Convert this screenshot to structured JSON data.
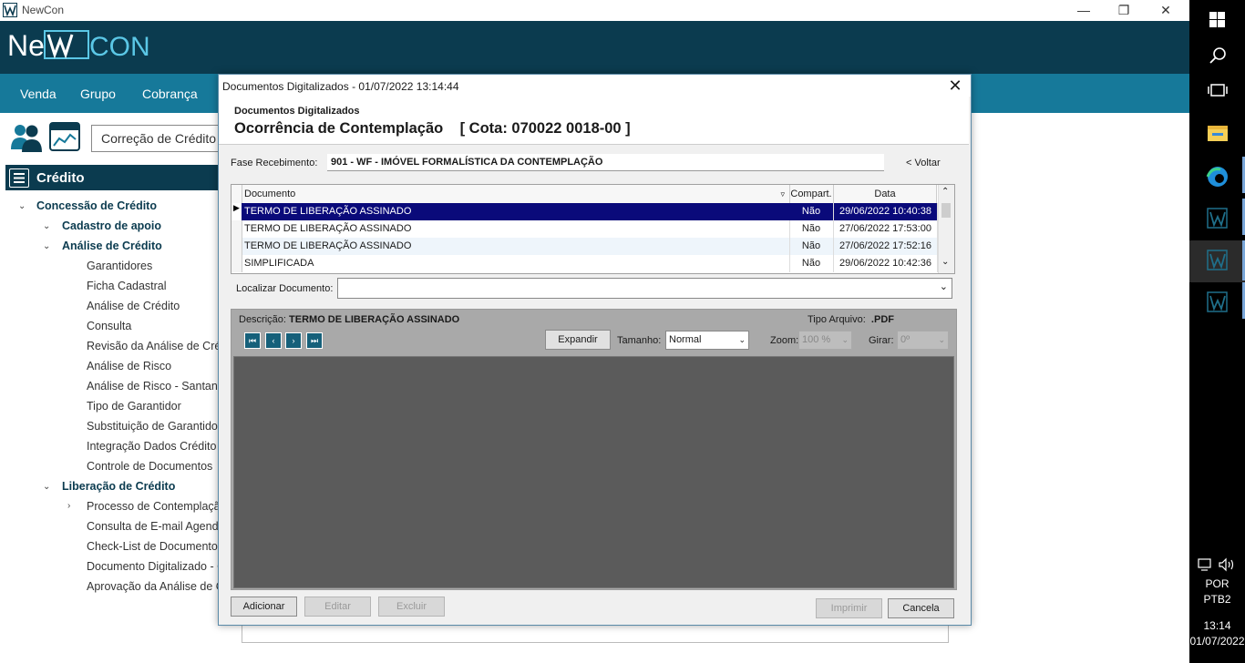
{
  "app": {
    "title": "NewCon",
    "logo_text": "NewCon",
    "menu": [
      "Venda",
      "Grupo",
      "Cobrança"
    ],
    "breadcrumb_value": "Correção de Crédito",
    "sidebar_header": "Crédito",
    "tree": [
      {
        "label": "Concessão de Crédito",
        "level": 1,
        "expanded": true
      },
      {
        "label": "Cadastro de apoio",
        "level": 2,
        "expanded": true
      },
      {
        "label": "Análise de Crédito",
        "level": 2,
        "expanded": true
      },
      {
        "label": "Garantidores",
        "level": 3
      },
      {
        "label": "Ficha Cadastral",
        "level": 3
      },
      {
        "label": "Análise de Crédito",
        "level": 3
      },
      {
        "label": "Consulta",
        "level": 3
      },
      {
        "label": "Revisão da Análise de Cré",
        "level": 3
      },
      {
        "label": "Análise de Risco",
        "level": 3
      },
      {
        "label": "Análise de Risco - Santan",
        "level": 3
      },
      {
        "label": "Tipo de Garantidor",
        "level": 3
      },
      {
        "label": "Substituição de Garantidor",
        "level": 3
      },
      {
        "label": "Integração Dados Crédito",
        "level": 3
      },
      {
        "label": "Controle de Documentos",
        "level": 3
      },
      {
        "label": "Liberação de Crédito",
        "level": 2,
        "expanded": true
      },
      {
        "label": "Processo de Contemplaçã",
        "level": 3,
        "collapsed": true
      },
      {
        "label": "Consulta de E-mail Agend",
        "level": 3
      },
      {
        "label": "Check-List de Documento",
        "level": 3
      },
      {
        "label": "Documento Digitalizado - C",
        "level": 3
      },
      {
        "label": "Aprovação da Análise de C",
        "level": 3
      }
    ]
  },
  "dialog": {
    "title": "Documentos Digitalizados - 01/07/2022  13:14:44",
    "subtitle": "Documentos Digitalizados",
    "heading": "Ocorrência de Contemplação    [ Cota: 070022 0018-00 ]",
    "fase_label": "Fase Recebimento:",
    "fase_value": "901 - WF - IMÓVEL FORMALÍSTICA DA CONTEMPLAÇÃO",
    "voltar": "< Voltar",
    "columns": [
      "Documento",
      "Compart.",
      "Data"
    ],
    "rows": [
      {
        "documento": "TERMO DE LIBERAÇÃO ASSINADO",
        "compart": "Não",
        "data": "29/06/2022 10:40:38",
        "selected": true
      },
      {
        "documento": "TERMO DE LIBERAÇÃO ASSINADO",
        "compart": "Não",
        "data": "27/06/2022 17:53:00"
      },
      {
        "documento": "TERMO DE LIBERAÇÃO ASSINADO",
        "compart": "Não",
        "data": "27/06/2022 17:52:16"
      },
      {
        "documento": "SIMPLIFICADA",
        "compart": "Não",
        "data": "29/06/2022 10:42:36"
      }
    ],
    "localizar_label": "Localizar Documento:",
    "localizar_value": "",
    "descricao_label": "Descrição:",
    "descricao_value": "TERMO DE LIBERAÇÃO ASSINADO",
    "tipo_label": "Tipo Arquivo:",
    "tipo_value": ".PDF",
    "expandir": "Expandir",
    "tamanho_label": "Tamanho:",
    "tamanho_value": "Normal",
    "zoom_label": "Zoom:",
    "zoom_value": "100 %",
    "girar_label": "Girar:",
    "girar_value": "0º",
    "buttons": {
      "adicionar": "Adicionar",
      "editar": "Editar",
      "excluir": "Excluir",
      "imprimir": "Imprimir",
      "cancela": "Cancela"
    }
  },
  "taskbar": {
    "lang1": "POR",
    "lang2": "PTB2",
    "time": "13:14",
    "date": "01/07/2022"
  },
  "colors": {
    "brand_dark": "#0b3b4f",
    "menu_blue": "#16799a",
    "selection": "#0a0a7a"
  }
}
